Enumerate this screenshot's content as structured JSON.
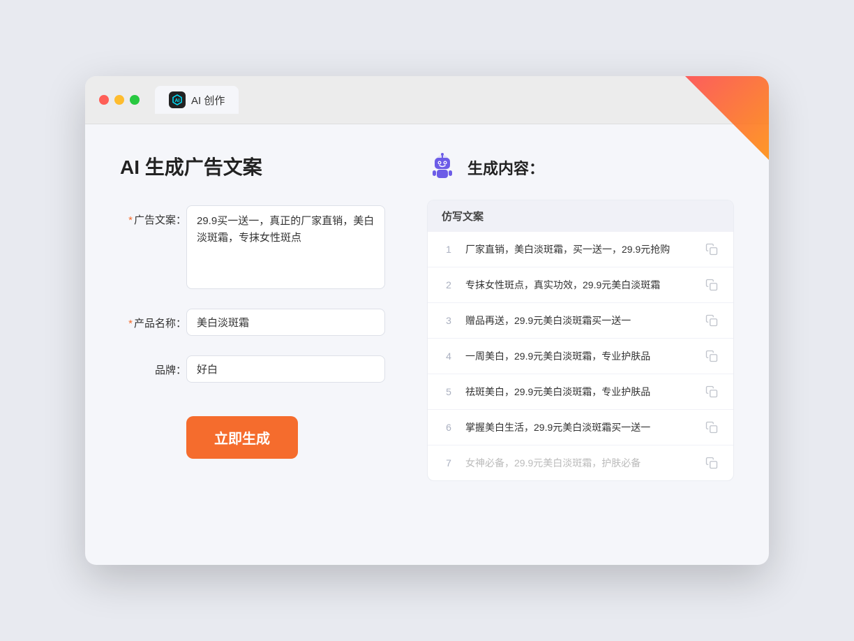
{
  "window": {
    "tab_label": "AI 创作"
  },
  "left": {
    "page_title": "AI 生成广告文案",
    "fields": [
      {
        "id": "ad_copy",
        "label": "广告文案：",
        "required": true,
        "type": "textarea",
        "value": "29.9买一送一，真正的厂家直销，美白淡斑霜，专抹女性斑点",
        "placeholder": ""
      },
      {
        "id": "product_name",
        "label": "产品名称：",
        "required": true,
        "type": "input",
        "value": "美白淡斑霜",
        "placeholder": ""
      },
      {
        "id": "brand",
        "label": "品牌：",
        "required": false,
        "type": "input",
        "value": "好白",
        "placeholder": ""
      }
    ],
    "generate_btn_label": "立即生成"
  },
  "right": {
    "title": "生成内容：",
    "table_header": "仿写文案",
    "results": [
      {
        "num": "1",
        "text": "厂家直销，美白淡斑霜，买一送一，29.9元抢购",
        "faded": false
      },
      {
        "num": "2",
        "text": "专抹女性斑点，真实功效，29.9元美白淡斑霜",
        "faded": false
      },
      {
        "num": "3",
        "text": "赠品再送，29.9元美白淡斑霜买一送一",
        "faded": false
      },
      {
        "num": "4",
        "text": "一周美白，29.9元美白淡斑霜，专业护肤品",
        "faded": false
      },
      {
        "num": "5",
        "text": "祛斑美白，29.9元美白淡斑霜，专业护肤品",
        "faded": false
      },
      {
        "num": "6",
        "text": "掌握美白生活，29.9元美白淡斑霜买一送一",
        "faded": false
      },
      {
        "num": "7",
        "text": "女神必备，29.9元美白淡斑霜，护肤必备",
        "faded": true
      }
    ]
  },
  "colors": {
    "accent": "#f56c2d",
    "required_star": "#f56c2d"
  }
}
